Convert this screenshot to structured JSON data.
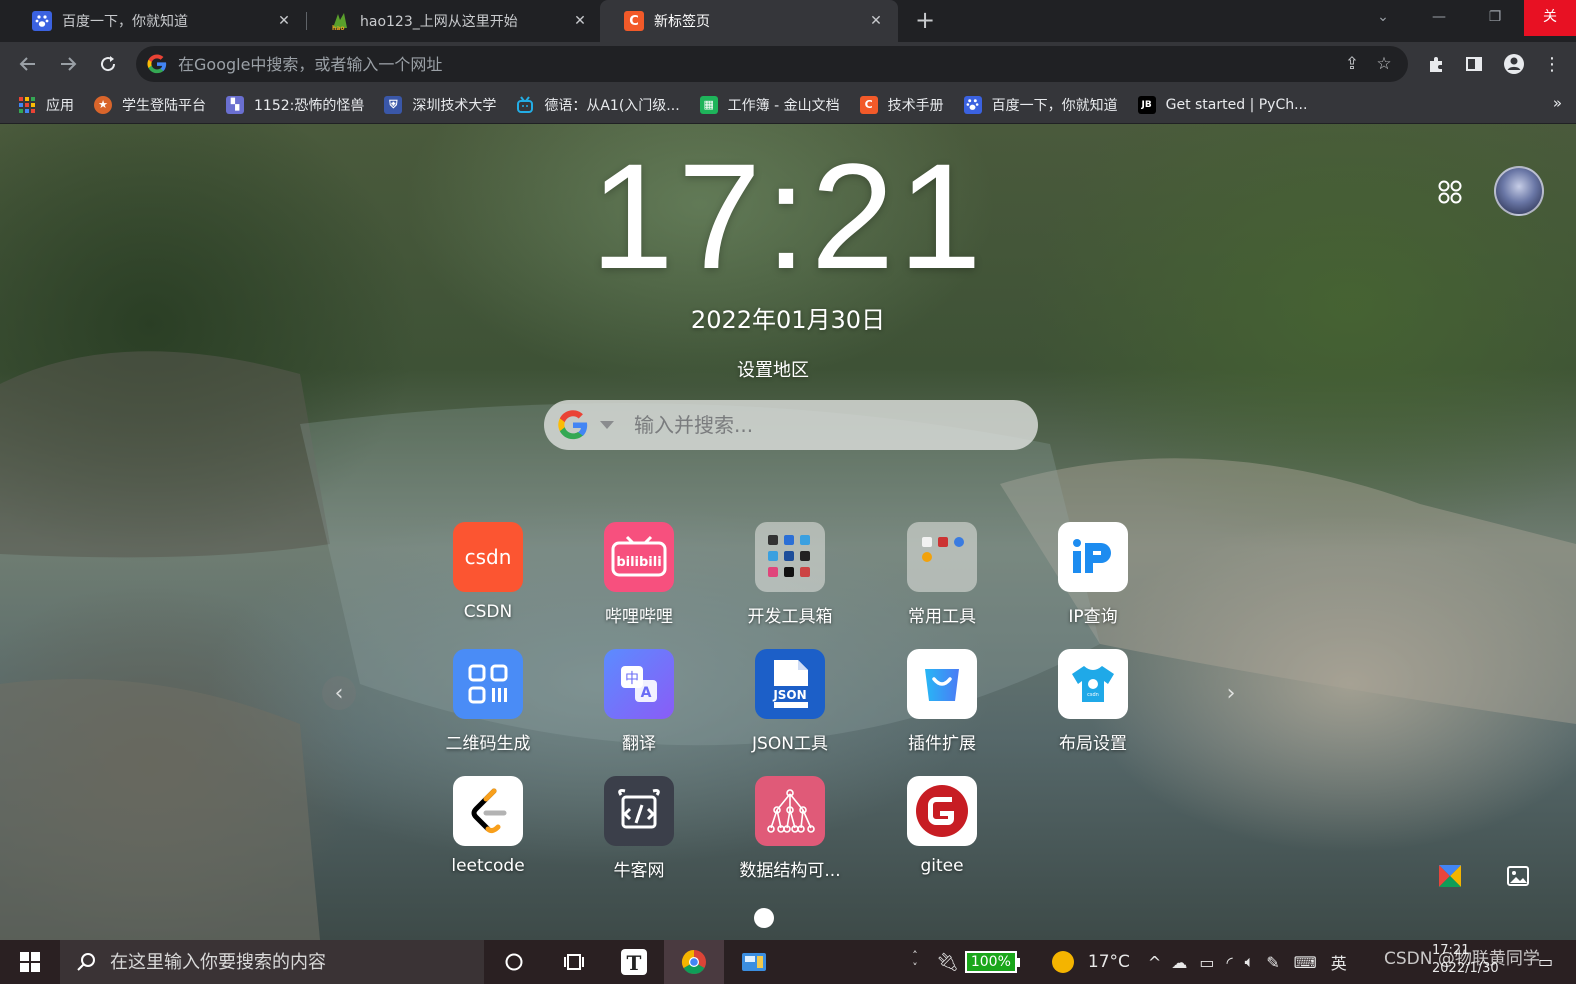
{
  "tabs": [
    {
      "title": "百度一下，你就知道",
      "favicon": "baidu-paw-icon",
      "color": "#3b62e0"
    },
    {
      "title": "hao123_上网从这里开始",
      "favicon": "hao123-icon",
      "color": "#5aa02c"
    },
    {
      "title": "新标签页",
      "favicon": "csdn-c-icon",
      "color": "#f25a29"
    }
  ],
  "window_close_label": "关",
  "omnibox": {
    "placeholder": "在Google中搜索，或者输入一个网址"
  },
  "bookmarks": [
    {
      "label": "应用",
      "icon": "apps-grid-icon",
      "color": "#ea4335"
    },
    {
      "label": "学生登陆平台",
      "icon": "medal-icon",
      "color": "#d9652b"
    },
    {
      "label": "1152:恐怖的怪兽",
      "icon": "pixel-monster-icon",
      "color": "#6a6fd0"
    },
    {
      "label": "深圳技术大学",
      "icon": "university-shield-icon",
      "color": "#3a57a8"
    },
    {
      "label": "德语：从A1(入门级...",
      "icon": "bilibili-tv-icon",
      "color": "#23ade5"
    },
    {
      "label": "工作簿 - 金山文档",
      "icon": "spreadsheet-icon",
      "color": "#1eb45a"
    },
    {
      "label": "技术手册",
      "icon": "csdn-c-icon",
      "color": "#f25a29"
    },
    {
      "label": "百度一下，你就知道",
      "icon": "baidu-paw-icon",
      "color": "#3b62e0"
    },
    {
      "label": "Get started | PyCh...",
      "icon": "jetbrains-icon",
      "color": "#000000"
    }
  ],
  "newtab": {
    "time": "17:21",
    "date": "2022年01月30日",
    "region": "设置地区",
    "search_placeholder": "输入并搜索..."
  },
  "apps": [
    {
      "label": "CSDN",
      "icon": "csdn-logo-icon"
    },
    {
      "label": "哔哩哔哩",
      "icon": "bilibili-logo-icon"
    },
    {
      "label": "开发工具箱",
      "icon": "dev-toolbox-folder-icon"
    },
    {
      "label": "常用工具",
      "icon": "tools-folder-icon"
    },
    {
      "label": "IP查询",
      "icon": "ip-lookup-icon"
    },
    {
      "label": "二维码生成",
      "icon": "qrcode-icon"
    },
    {
      "label": "翻译",
      "icon": "translate-icon"
    },
    {
      "label": "JSON工具",
      "icon": "json-file-icon"
    },
    {
      "label": "插件扩展",
      "icon": "shopping-bag-icon"
    },
    {
      "label": "布局设置",
      "icon": "tshirt-icon"
    },
    {
      "label": "leetcode",
      "icon": "leetcode-icon"
    },
    {
      "label": "牛客网",
      "icon": "nowcoder-icon"
    },
    {
      "label": "数据结构可...",
      "icon": "tree-structure-icon"
    },
    {
      "label": "gitee",
      "icon": "gitee-icon"
    }
  ],
  "taskbar": {
    "search_placeholder": "在这里输入你要搜索的内容",
    "battery": "100%",
    "temperature": "17°C",
    "ime": "英",
    "clock_time": "17:21",
    "clock_date": "2022/1/30",
    "watermark": "CSDN @物联黄同学"
  }
}
